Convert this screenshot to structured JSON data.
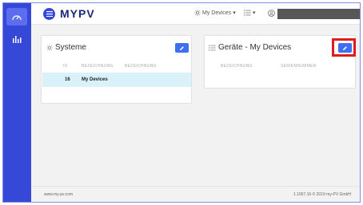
{
  "header": {
    "brand": "MYPV",
    "devices_menu": "My Devices",
    "devices_caret": "▾",
    "list_caret": "▾"
  },
  "systems_card": {
    "title": "Systeme",
    "columns": [
      "ID",
      "BEZEICHNUNG",
      "BEZEICHNUNG"
    ],
    "rows": [
      {
        "id": "16",
        "name": "My Devices"
      }
    ]
  },
  "devices_card": {
    "title": "Geräte - My Devices",
    "columns": [
      "BEZEICHNUNG",
      "SERIENNUMMER"
    ]
  },
  "footer": {
    "left": "www.my-pv.com",
    "right": "1.1057.16 © 2019 my-PV GmbH"
  },
  "colors": {
    "sidebar": "#3548d8",
    "accent_button": "#3d6ff0",
    "highlight": "#e11a1a",
    "selected_row": "#d9f1f8"
  },
  "icons": [
    "menu-icon",
    "dashboard-icon",
    "bar-chart-icon",
    "sun-icon",
    "list-icon",
    "user-icon",
    "pencil-icon"
  ]
}
